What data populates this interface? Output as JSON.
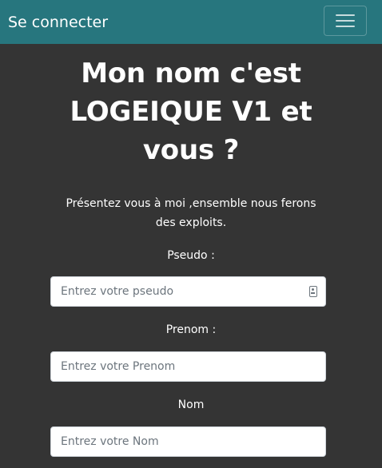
{
  "navbar": {
    "brand": "Se connecter",
    "toggler_icon": "hamburger-menu-icon"
  },
  "main": {
    "title": "Mon nom c'est LOGEIQUE V1 et vous ?",
    "intro": "Présentez vous à moi ,ensemble nous ferons des exploits."
  },
  "form": {
    "pseudo": {
      "label": "Pseudo :",
      "placeholder": "Entrez votre pseudo",
      "icon": "contact-card-icon"
    },
    "prenom": {
      "label": "Prenom :",
      "placeholder": "Entrez votre Prenom"
    },
    "nom": {
      "label": "Nom",
      "placeholder": "Entrez votre Nom"
    }
  },
  "colors": {
    "navbar_bg": "#27767e",
    "page_bg": "#343434",
    "text": "#ffffff"
  }
}
